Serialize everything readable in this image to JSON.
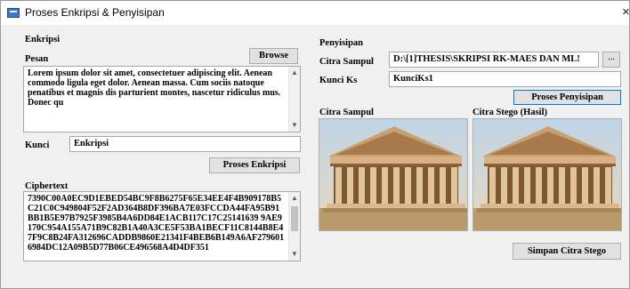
{
  "window": {
    "title": "Proses Enkripsi & Penyisipan",
    "close": "×"
  },
  "enkripsi": {
    "group_label": "Enkripsi",
    "pesan_label": "Pesan",
    "browse_label": "Browse",
    "message": "Lorem ipsum dolor sit amet, consectetuer adipiscing elit. Aenean commodo ligula eget dolor. Aenean massa. Cum sociis natoque penatibus et magnis dis parturient montes, nascetur ridiculus mus. Donec qu",
    "kunci_label": "Kunci",
    "kunci_value": "Enkripsi",
    "proses_label": "Proses Enkripsi",
    "ciphertext_label": "Ciphertext",
    "ciphertext": "7390C00A0EC9D1EBED54BC9F8B6275F65E34EE4F4B909178B5C21C0C949804F52F2AD364B8DF396BA7E03FCCDA44FA95B91BB1B5E97B7925F3985B4A6DD84E1ACB117C17C25141639 9AE9170C954A155A71B9C82B1A40A3CE5F53BA1BECF11C8144B8E47F9C8B24FA312696CADDB9860E21341F4BEB6B149A6AF2796016984DC12A09B5D77B06CE496568A4D4DF351"
  },
  "penyisipan": {
    "group_label": "Penyisipan",
    "citra_sampul_label": "Citra Sampul",
    "citra_sampul_value": "D:\\[1]THESIS\\SKRIPSI RK-MAES DAN ML!",
    "browse_small_label": "...",
    "kunci_ks_label": "Kunci Ks",
    "kunci_ks_value": "KunciKs1",
    "proses_label": "Proses Penyisipan",
    "img1_label": "Citra Sampul",
    "img2_label": "Citra Stego (Hasil)",
    "simpan_label": "Simpan Citra Stego"
  },
  "colors": {
    "window_bg": "#f0f0f0",
    "focus_border": "#0078d7"
  }
}
